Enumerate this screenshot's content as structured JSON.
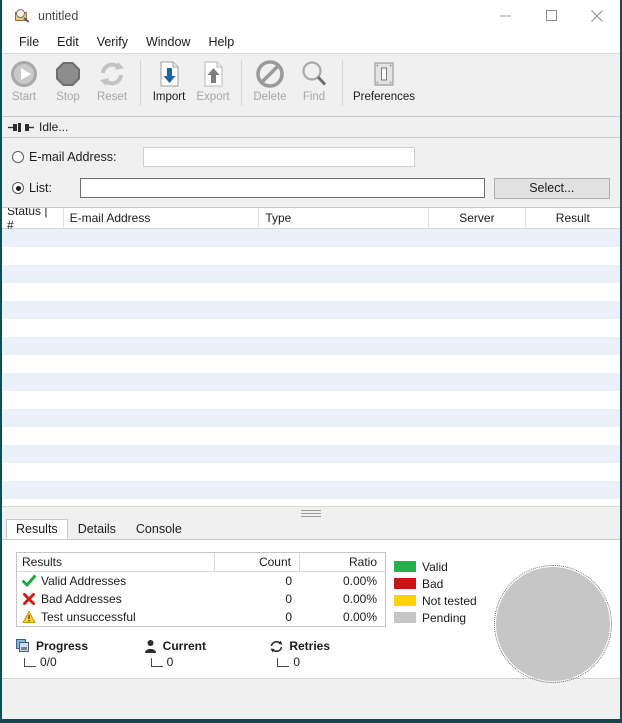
{
  "window": {
    "title": "untitled",
    "app_icon": "mail-magnifier-icon",
    "controls": {
      "minimize": "minimize-icon",
      "maximize": "maximize-icon",
      "close": "close-icon"
    }
  },
  "menubar": {
    "items": [
      {
        "label": "File"
      },
      {
        "label": "Edit"
      },
      {
        "label": "Verify"
      },
      {
        "label": "Window"
      },
      {
        "label": "Help"
      }
    ]
  },
  "toolbar": {
    "buttons": [
      {
        "label": "Start",
        "icon": "play-circle-icon",
        "enabled": false
      },
      {
        "label": "Stop",
        "icon": "stop-octagon-icon",
        "enabled": false
      },
      {
        "label": "Reset",
        "icon": "refresh-arrows-icon",
        "enabled": false
      },
      {
        "label": "Import",
        "icon": "import-down-arrow-document-icon",
        "enabled": true
      },
      {
        "label": "Export",
        "icon": "export-up-arrow-document-icon",
        "enabled": false
      },
      {
        "label": "Delete",
        "icon": "no-entry-icon",
        "enabled": false
      },
      {
        "label": "Find",
        "icon": "magnifier-icon",
        "enabled": false
      },
      {
        "label": "Preferences",
        "icon": "light-switch-icon",
        "enabled": true
      }
    ]
  },
  "statusbar": {
    "icon": "connector-plug-icon",
    "text": "Idle..."
  },
  "input_form": {
    "email_option": {
      "label": "E-mail Address:",
      "selected": false,
      "value": "",
      "placeholder": ""
    },
    "list_option": {
      "label": "List:",
      "selected": true,
      "value": "",
      "placeholder": ""
    },
    "select_button": "Select..."
  },
  "list_view": {
    "columns": [
      "Status | #",
      "E-mail Address",
      "Type",
      "Server",
      "Result"
    ],
    "rows": []
  },
  "bottom_tabs": {
    "tabs": [
      {
        "label": "Results",
        "active": true
      },
      {
        "label": "Details",
        "active": false
      },
      {
        "label": "Console",
        "active": false
      }
    ]
  },
  "results_panel": {
    "table": {
      "headers": [
        "Results",
        "Count",
        "Ratio"
      ],
      "rows": [
        {
          "icon": "green-check-icon",
          "label": "Valid Addresses",
          "count": "0",
          "ratio": "0.00%"
        },
        {
          "icon": "red-cross-icon",
          "label": "Bad Addresses",
          "count": "0",
          "ratio": "0.00%"
        },
        {
          "icon": "yellow-warning-icon",
          "label": "Test unsuccessful",
          "count": "0",
          "ratio": "0.00%"
        }
      ]
    },
    "legend": [
      {
        "label": "Valid",
        "color": "#22b14c"
      },
      {
        "label": "Bad",
        "color": "#c81414"
      },
      {
        "label": "Not tested",
        "color": "#ffd400"
      },
      {
        "label": "Pending",
        "color": "#c6c6c6"
      }
    ],
    "stats": [
      {
        "icon": "progress-stack-icon",
        "label": "Progress",
        "value": "0/0"
      },
      {
        "icon": "person-icon",
        "label": "Current",
        "value": "0"
      },
      {
        "icon": "retry-arrows-icon",
        "label": "Retries",
        "value": "0"
      }
    ]
  },
  "chart_data": {
    "type": "pie",
    "title": "",
    "categories": [
      "Valid",
      "Bad",
      "Not tested",
      "Pending"
    ],
    "values": [
      0,
      0,
      0,
      100
    ],
    "colors": [
      "#22b14c",
      "#c81414",
      "#ffd400",
      "#c6c6c6"
    ],
    "legend_position": "left"
  }
}
